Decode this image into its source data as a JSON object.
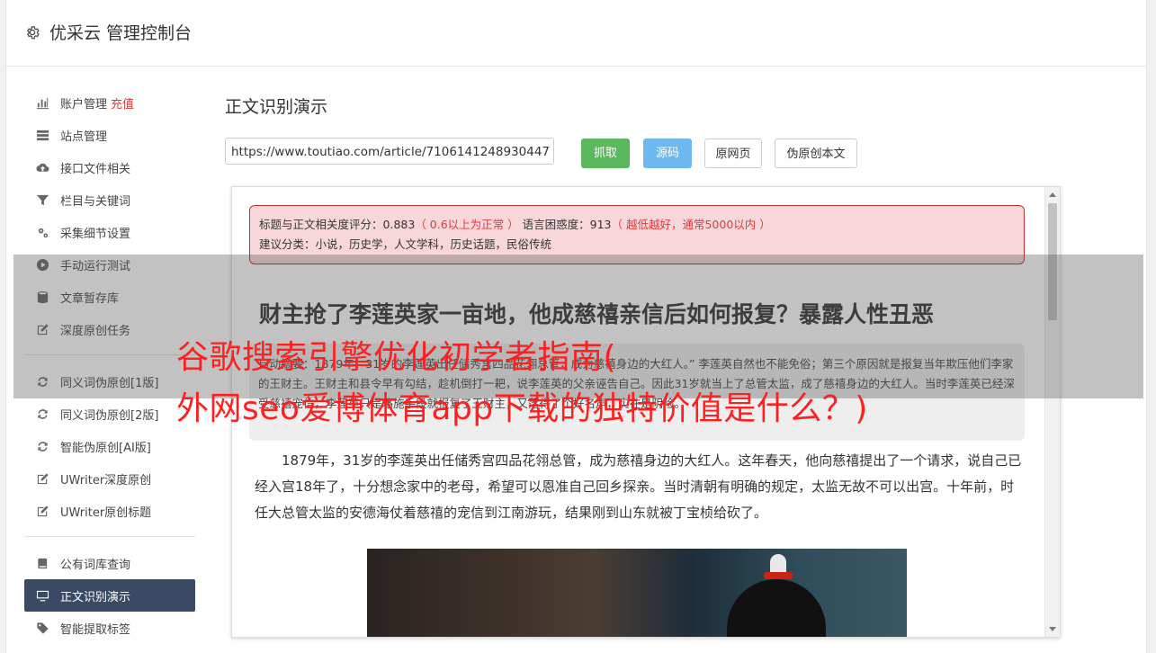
{
  "app": {
    "title": "优采云 管理控制台"
  },
  "sidebar": {
    "groups": [
      [
        {
          "label": "账户管理",
          "badge": "充值",
          "icon": "bar-chart-icon",
          "name": "sidebar-item-account"
        },
        {
          "label": "站点管理",
          "icon": "server-icon",
          "name": "sidebar-item-sites"
        },
        {
          "label": "接口文件相关",
          "icon": "cloud-upload-icon",
          "name": "sidebar-item-api-files"
        },
        {
          "label": "栏目与关键词",
          "icon": "filter-icon",
          "name": "sidebar-item-columns-keywords"
        },
        {
          "label": "采集细节设置",
          "icon": "gears-icon",
          "name": "sidebar-item-collect-settings"
        },
        {
          "label": "手动运行测试",
          "icon": "play-circle-icon",
          "name": "sidebar-item-manual-test"
        },
        {
          "label": "文章暂存库",
          "icon": "database-icon",
          "name": "sidebar-item-article-storage"
        },
        {
          "label": "深度原创任务",
          "icon": "edit-icon",
          "name": "sidebar-item-deep-original"
        }
      ],
      [
        {
          "label": "同义词伪原创[1版]",
          "icon": "refresh-icon",
          "name": "sidebar-item-synonym-v1"
        },
        {
          "label": "同义词伪原创[2版]",
          "icon": "refresh-icon",
          "name": "sidebar-item-synonym-v2"
        },
        {
          "label": "智能伪原创[AI版]",
          "icon": "refresh-icon",
          "name": "sidebar-item-ai-rewrite"
        },
        {
          "label": "UWriter深度原创",
          "icon": "edit-icon",
          "name": "sidebar-item-uwriter-deep"
        },
        {
          "label": "UWriter原创标题",
          "icon": "edit-icon",
          "name": "sidebar-item-uwriter-title"
        }
      ],
      [
        {
          "label": "公有词库查询",
          "icon": "book-icon",
          "name": "sidebar-item-public-lexicon"
        },
        {
          "label": "正文识别演示",
          "icon": "monitor-icon",
          "name": "sidebar-item-text-recognition",
          "active": true
        },
        {
          "label": "智能提取标签",
          "icon": "tag-icon",
          "name": "sidebar-item-smart-tags"
        }
      ]
    ]
  },
  "main": {
    "title": "正文识别演示",
    "url_value": "https://www.toutiao.com/article/7106141248930447",
    "buttons": {
      "fetch": "抓取",
      "source": "源码",
      "original": "原网页",
      "rewrite": "伪原创本文"
    }
  },
  "result": {
    "score_label": "标题与正文相关度评分：",
    "score_value": "0.883",
    "score_hint": "（ 0.6以上为正常 ）",
    "confusion_label": "语言困惑度：",
    "confusion_value": "913",
    "confusion_hint": "（ 越低越好，通常5000以内 ）",
    "category_label": "建议分类：",
    "category_value": "小说，历史学，人文学科，历史话题，民俗传统"
  },
  "article": {
    "title": "财主抢了李莲英家一亩地，他成慈禧亲信后如何报复？暴露人性丑恶",
    "summary": "自动摘要：1879年，31岁的李莲英出任储秀宫四品花翎总管，成为慈禧身边的大红人。” 李莲英自然也不能免俗；第三个原因就是报复当年欺压他们李家的王财主。王财主和县令早有勾结，趁机倒打一耙，说李莲英的父亲诬告自己。因此31岁就当上了总管太监，成了慈禧身边的大红人。当时李莲英已经深受慈禧宠信，李莲英只是略施手段就报复了王财主，又落得了个好名声，实在是阴险。",
    "paragraph": "1879年，31岁的李莲英出任储秀宫四品花翎总管，成为慈禧身边的大红人。这年春天，他向慈禧提出了一个请求，说自己已经入宫18年了，十分想念家中的老母，希望可以恩准自己回乡探亲。当时清朝有明确的规定，太监无故不可以出宫。十年前，时任大总管太监的安德海仗着慈禧的宠信到江南游玩，结果刚到山东就被丁宝桢给砍了。"
  },
  "overlay": {
    "line1": "谷歌搜索引擎优化初学者指南(",
    "line2": "外网seo爱博体育app下载的独特价值是什么？)"
  }
}
